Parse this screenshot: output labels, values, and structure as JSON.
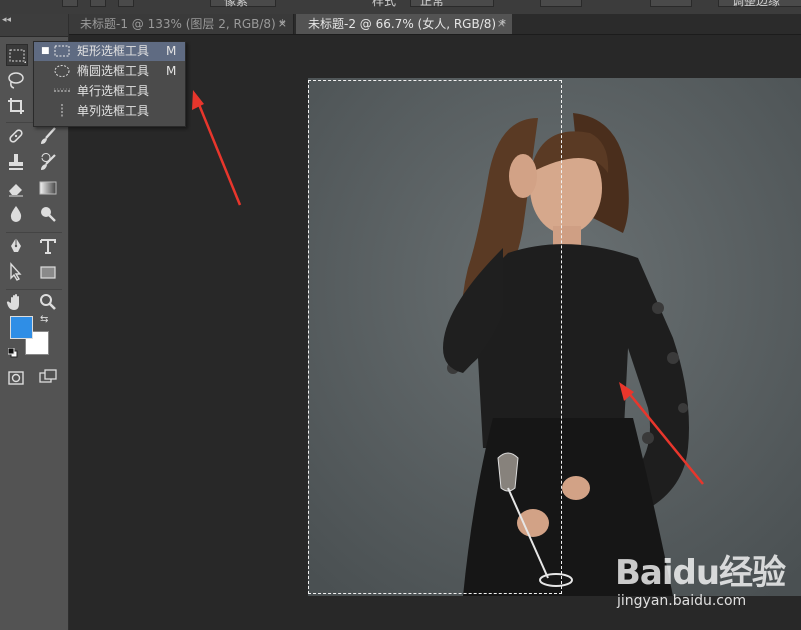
{
  "option_bar": {
    "feather_unit": "像素",
    "style_label": "样式",
    "style_value": "正常",
    "refine_edge": "调整边缘"
  },
  "tabs": [
    {
      "label": "未标题-1 @ 133% (图层 2, RGB/8) *",
      "close": "×"
    },
    {
      "label": "未标题-2 @ 66.7% (女人, RGB/8) *",
      "close": "×"
    }
  ],
  "toolbar": {
    "collapse": "◂◂",
    "colors": {
      "foreground": "#2f8ee6",
      "background": "#ffffff"
    }
  },
  "flyout": {
    "items": [
      {
        "label": "矩形选框工具",
        "shortcut": "M",
        "icon": "rect-marquee-icon",
        "active": true
      },
      {
        "label": "椭圆选框工具",
        "shortcut": "M",
        "icon": "ellipse-marquee-icon",
        "active": false
      },
      {
        "label": "单行选框工具",
        "shortcut": "",
        "icon": "single-row-marquee-icon",
        "active": false
      },
      {
        "label": "单列选框工具",
        "shortcut": "",
        "icon": "single-column-marquee-icon",
        "active": false
      }
    ],
    "active_bullet": "■"
  },
  "watermark": {
    "logo": "Baidu经验",
    "url": "jingyan.baidu.com"
  },
  "annotation_color": "#e8362c"
}
